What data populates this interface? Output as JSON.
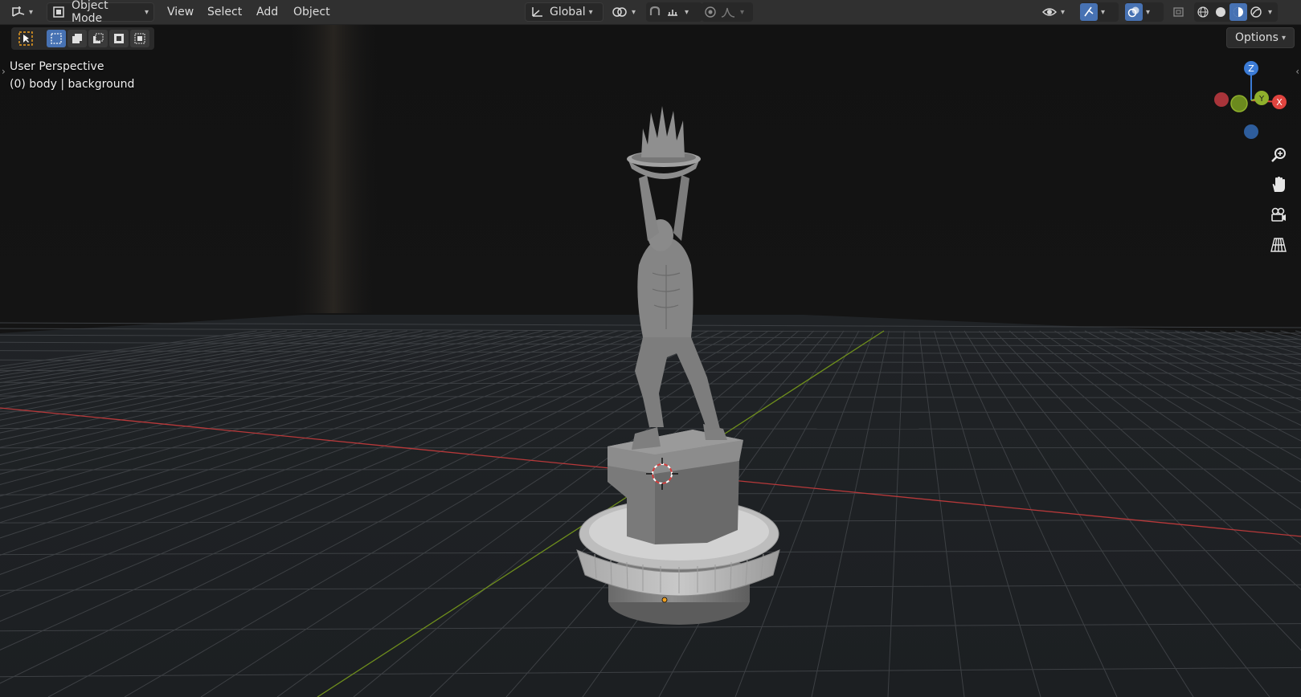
{
  "header": {
    "editor_type_icon": "3d-viewport-icon",
    "mode": "Object Mode",
    "menus": [
      "View",
      "Select",
      "Add",
      "Object"
    ],
    "orientation": "Global"
  },
  "toolbar": {
    "tools": [
      "select-tool-icon",
      "select-box-new-icon",
      "select-box-extend-icon",
      "select-box-subtract-icon",
      "select-box-invert-icon",
      "select-box-intersect-icon"
    ]
  },
  "options": {
    "label": "Options"
  },
  "viewport": {
    "view_name": "User Perspective",
    "object_info": "(0) body | background"
  },
  "gizmo": {
    "x": "X",
    "y": "Y",
    "z": "Z"
  },
  "colors": {
    "accent": "#4772b3",
    "x_axis": "#e0443f",
    "y_axis": "#7a9c1f",
    "z_axis": "#3b7bd6",
    "grid": "#3d3f42",
    "background": "#1b1b1b"
  }
}
